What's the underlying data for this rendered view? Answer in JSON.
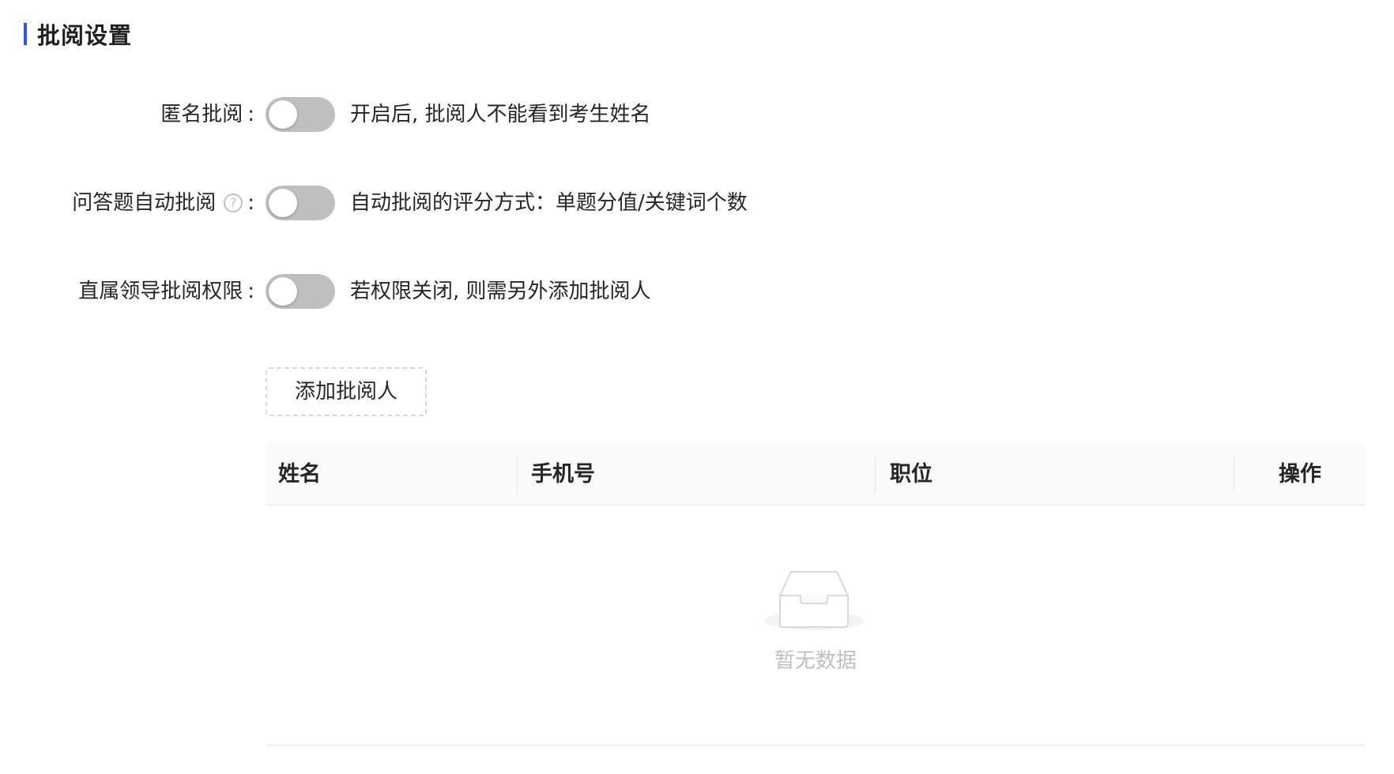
{
  "section": {
    "title": "批阅设置"
  },
  "settings": [
    {
      "label": "匿名批阅",
      "colon": ":",
      "enabled": false,
      "hint": "开启后, 批阅人不能看到考生姓名"
    },
    {
      "label": "问答题自动批阅",
      "colon": ":",
      "has_help_icon": true,
      "help_icon_glyph": "?",
      "enabled": false,
      "hint": "自动批阅的评分方式：单题分值/关键词个数"
    },
    {
      "label": "直属领导批阅权限",
      "colon": ":",
      "enabled": false,
      "hint": "若权限关闭, 则需另外添加批阅人"
    }
  ],
  "reviewers": {
    "add_button_label": "添加批阅人",
    "columns": [
      "姓名",
      "手机号",
      "职位",
      "操作"
    ],
    "rows": [],
    "empty_text": "暂无数据"
  },
  "colors": {
    "accent": "#2f54eb",
    "switch_off": "#bfbfbf",
    "header_bg": "#fafafa",
    "muted_text": "#bfbfbf"
  },
  "icons": {
    "help": "question-circle-icon",
    "empty": "inbox-icon"
  }
}
